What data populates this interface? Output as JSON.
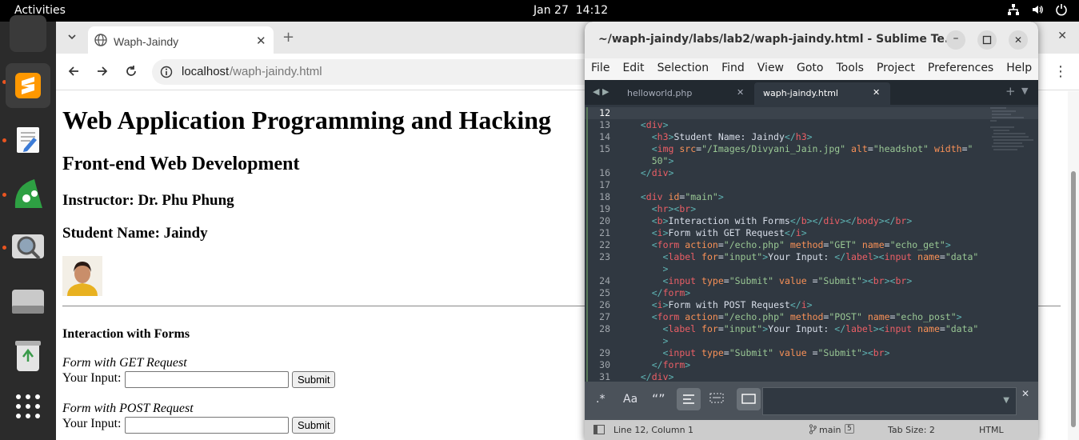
{
  "topbar": {
    "activities": "Activities",
    "date": "Jan 27",
    "time": "14:12"
  },
  "browser": {
    "tab_title": "Waph-Jaindy",
    "url_host": "localhost",
    "url_path": "/waph-jaindy.html"
  },
  "page": {
    "h1": "Web Application Programming and Hacking",
    "h2": "Front-end Web Development",
    "instructor": "Instructor: Dr. Phu Phung",
    "student": "Student Name: Jaindy",
    "forms_heading": "Interaction with Forms",
    "get_title": "Form with GET Request",
    "post_title": "Form with POST Request",
    "input_label": "Your Input:",
    "submit_label": "Submit"
  },
  "sublime": {
    "title": "~/waph-jaindy/labs/lab2/waph-jaindy.html - Sublime Te...",
    "menu": [
      "File",
      "Edit",
      "Selection",
      "Find",
      "View",
      "Goto",
      "Tools",
      "Project",
      "Preferences",
      "Help"
    ],
    "tabs": [
      "helloworld.php",
      "waph-jaindy.html"
    ],
    "code_lines": [
      {
        "n": "12"
      },
      {
        "n": "13"
      },
      {
        "n": "14"
      },
      {
        "n": "15"
      },
      {
        "n": ""
      },
      {
        "n": "16"
      },
      {
        "n": "17"
      },
      {
        "n": "18"
      },
      {
        "n": "19"
      },
      {
        "n": "20"
      },
      {
        "n": "21"
      },
      {
        "n": "22"
      },
      {
        "n": "23"
      },
      {
        "n": ""
      },
      {
        "n": "24"
      },
      {
        "n": "25"
      },
      {
        "n": "26"
      },
      {
        "n": "27"
      },
      {
        "n": "28"
      },
      {
        "n": ""
      },
      {
        "n": "29"
      },
      {
        "n": "30"
      },
      {
        "n": "31"
      }
    ],
    "status": {
      "position": "Line 12, Column 1",
      "branch": "main",
      "branch_count": "5",
      "tab_size": "Tab Size: 2",
      "syntax": "HTML"
    }
  }
}
